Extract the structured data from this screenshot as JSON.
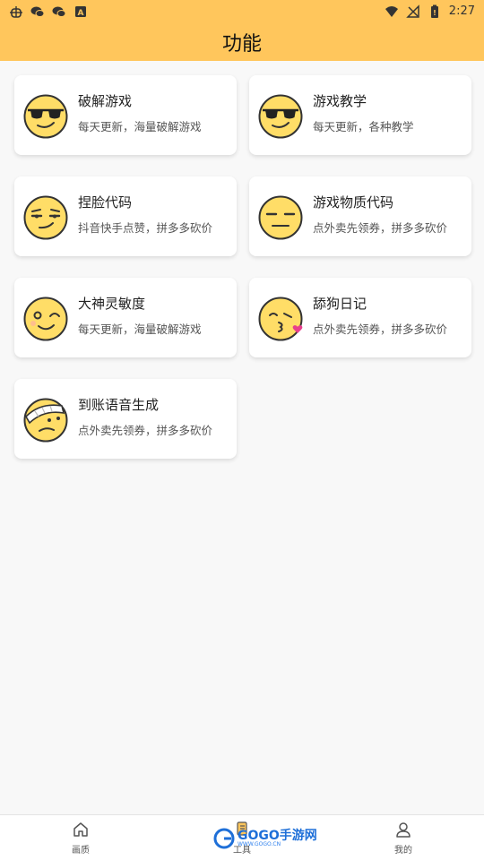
{
  "status_bar": {
    "time": "2:27",
    "left_icons": [
      "bug-icon",
      "wechat-icon",
      "wechat-icon",
      "font-icon"
    ],
    "right_icons": [
      "wifi-icon",
      "signal-off-icon",
      "battery-icon"
    ]
  },
  "app_bar": {
    "title": "功能"
  },
  "features": [
    {
      "title": "破解游戏",
      "subtitle": "每天更新，海量破解游戏",
      "icon": "sunglasses-face-icon"
    },
    {
      "title": "游戏教学",
      "subtitle": "每天更新，各种教学",
      "icon": "sunglasses-face-icon"
    },
    {
      "title": "捏脸代码",
      "subtitle": "抖音快手点赞，拼多多砍价",
      "icon": "smirk-face-icon"
    },
    {
      "title": "游戏物质代码",
      "subtitle": "点外卖先领券，拼多多砍价",
      "icon": "expressionless-face-icon"
    },
    {
      "title": "大神灵敏度",
      "subtitle": "每天更新，海量破解游戏",
      "icon": "wink-face-icon"
    },
    {
      "title": "舔狗日记",
      "subtitle": "点外卖先领券，拼多多砍价",
      "icon": "kiss-face-icon"
    },
    {
      "title": "到账语音生成",
      "subtitle": "点外卖先领券，拼多多砍价",
      "icon": "bandaged-face-icon"
    }
  ],
  "bottom_nav": {
    "items": [
      {
        "label": "画质",
        "icon": "home-icon"
      },
      {
        "label": "工具",
        "icon": "tools-icon"
      },
      {
        "label": "我的",
        "icon": "user-icon"
      }
    ]
  },
  "watermark": {
    "text": "GOGO手游网",
    "sub": "WWW.GOGO.CN"
  },
  "colors": {
    "accent": "#ffc65c",
    "face": "#ffdd67",
    "face_outline": "#333333"
  }
}
